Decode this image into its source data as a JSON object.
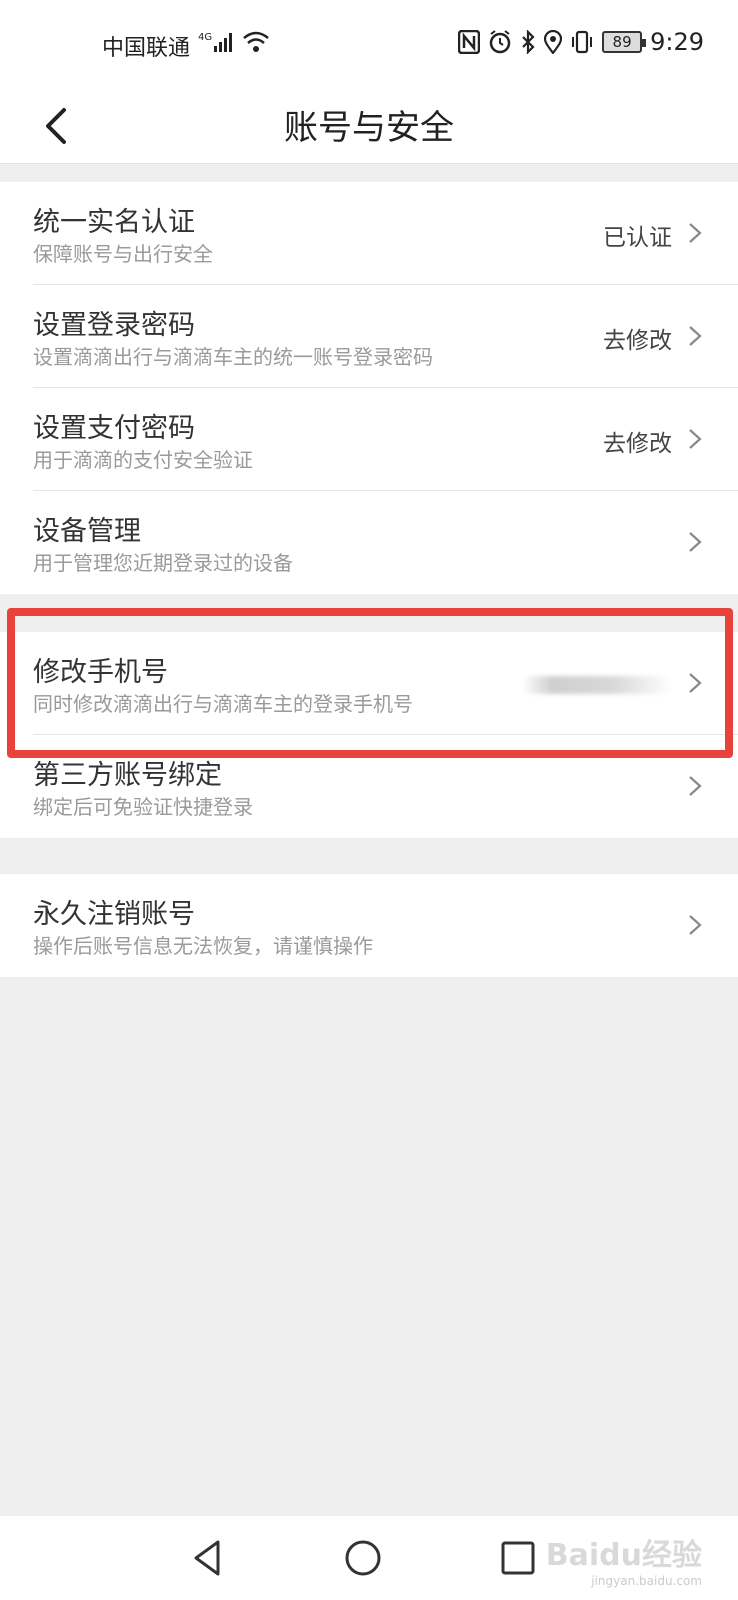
{
  "status_bar": {
    "carrier": "中国联通",
    "network": "4G",
    "battery": "89",
    "time": "9:29"
  },
  "header": {
    "title": "账号与安全"
  },
  "groups": [
    {
      "items": [
        {
          "title": "统一实名认证",
          "subtitle": "保障账号与出行安全",
          "value": "已认证"
        },
        {
          "title": "设置登录密码",
          "subtitle": "设置滴滴出行与滴滴车主的统一账号登录密码",
          "value": "去修改"
        },
        {
          "title": "设置支付密码",
          "subtitle": "用于滴滴的支付安全验证",
          "value": "去修改"
        },
        {
          "title": "设备管理",
          "subtitle": "用于管理您近期登录过的设备",
          "value": ""
        }
      ]
    },
    {
      "items": [
        {
          "title": "修改手机号",
          "subtitle": "同时修改滴滴出行与滴滴车主的登录手机号",
          "value": ""
        },
        {
          "title": "第三方账号绑定",
          "subtitle": "绑定后可免验证快捷登录",
          "value": ""
        }
      ]
    },
    {
      "items": [
        {
          "title": "永久注销账号",
          "subtitle": "操作后账号信息无法恢复，请谨慎操作",
          "value": ""
        }
      ]
    }
  ],
  "watermark": {
    "brand": "Baidu经验",
    "url": "jingyan.baidu.com"
  },
  "colors": {
    "highlight": "#e8433b",
    "background": "#efefef"
  }
}
